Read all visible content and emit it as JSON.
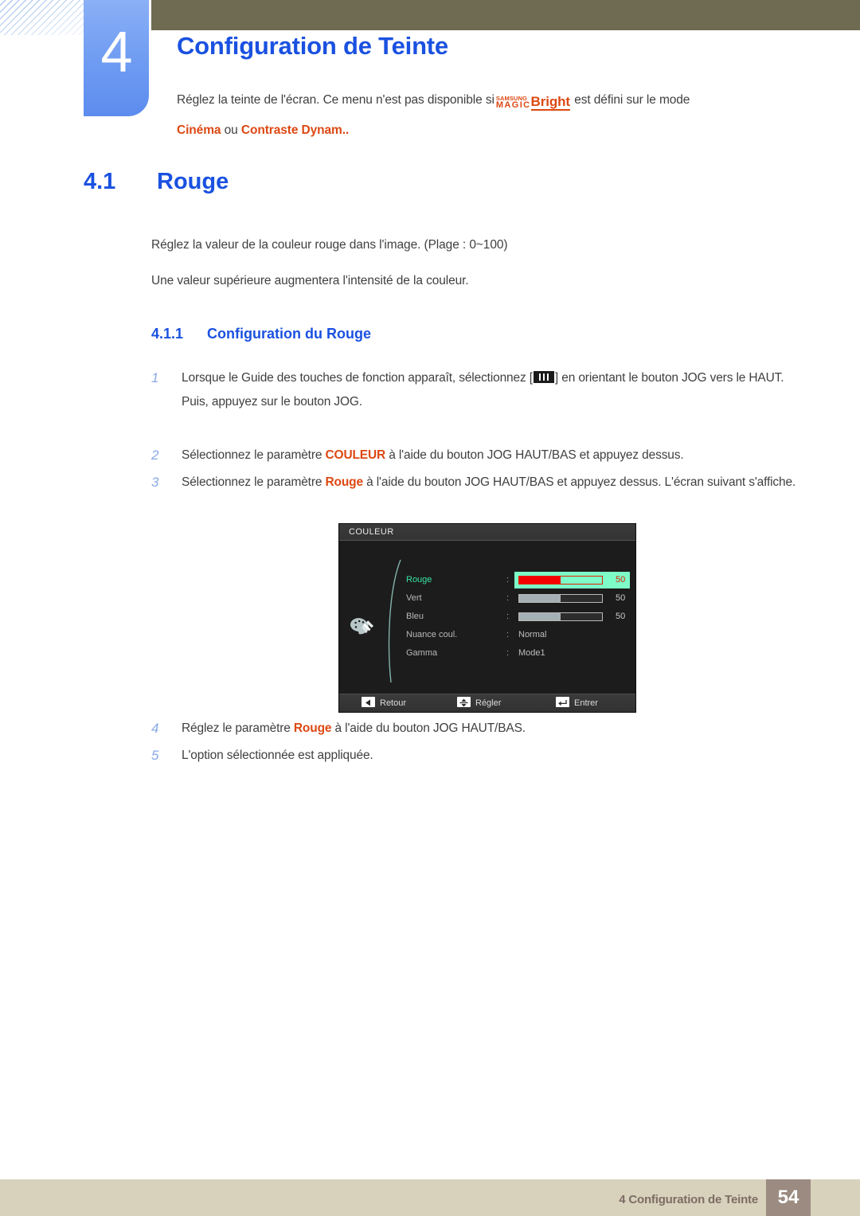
{
  "chapter": {
    "number": "4",
    "title": "Configuration de Teinte",
    "intro_before": "Réglez la teinte de l'écran. Ce menu n'est pas disponible si",
    "logo": {
      "samsung": "SAMSUNG",
      "magic": "MAGIC",
      "bright": "Bright"
    },
    "intro_after": "est défini sur le mode",
    "intro_mode_1": "Cinéma",
    "intro_mode_or": "ou",
    "intro_mode_2": "Contraste Dynam.."
  },
  "section": {
    "number": "4.1",
    "title": "Rouge",
    "paragraph_1": "Réglez la valeur de la couleur rouge dans l'image. (Plage : 0~100)",
    "paragraph_2": "Une valeur supérieure augmentera l'intensité de la couleur."
  },
  "subsection": {
    "number": "4.1.1",
    "title": "Configuration du Rouge"
  },
  "steps": [
    {
      "index": "1",
      "part_a": "Lorsque le Guide des touches de fonction apparaît, sélectionnez [",
      "icon": "jog-bars-icon",
      "part_b": "] en orientant le bouton JOG vers le HAUT.",
      "extra": "Puis, appuyez sur le bouton JOG."
    },
    {
      "index": "2",
      "part_a": "Sélectionnez le paramètre",
      "highlight": "COULEUR",
      "part_b": "à l'aide du bouton JOG HAUT/BAS et appuyez dessus."
    },
    {
      "index": "3",
      "part_a": "Sélectionnez le paramètre",
      "highlight": "Rouge",
      "part_b": "à l'aide du bouton JOG HAUT/BAS et appuyez dessus. L'écran suivant s'affiche."
    },
    {
      "index": "4",
      "part_a": "Réglez le paramètre",
      "highlight": "Rouge",
      "part_b": "à l'aide du bouton JOG HAUT/BAS."
    },
    {
      "index": "5",
      "part_a": "L'option sélectionnée est appliquée."
    }
  ],
  "osd": {
    "title": "COULEUR",
    "icon": "color-palette-icon",
    "rows": [
      {
        "label": "Rouge",
        "colon": ":",
        "type": "slider",
        "percent": 50,
        "number": "50",
        "selected": true
      },
      {
        "label": "Vert",
        "colon": ":",
        "type": "slider",
        "percent": 50,
        "number": "50",
        "selected": false
      },
      {
        "label": "Bleu",
        "colon": ":",
        "type": "slider",
        "percent": 50,
        "number": "50",
        "selected": false
      },
      {
        "label": "Nuance coul.",
        "colon": ":",
        "type": "value",
        "value": "Normal",
        "selected": false
      },
      {
        "label": "Gamma",
        "colon": ":",
        "type": "value",
        "value": "Mode1",
        "selected": false
      }
    ],
    "footer": [
      {
        "icon": "left-arrow-icon",
        "label": "Retour"
      },
      {
        "icon": "up-down-arrow-icon",
        "label": "Régler"
      },
      {
        "icon": "enter-arrow-icon",
        "label": "Entrer"
      }
    ],
    "colors": {
      "highlight": "#7dfcc8",
      "red_fill": "#f40000",
      "selected_label": "#37e3a4",
      "bar_fill": "#a5b0b4"
    }
  },
  "footer": {
    "text": "4 Configuration de Teinte",
    "page": "54"
  },
  "theme": {
    "heading_blue": "#1a51e0",
    "accent_orange": "#dd4813",
    "topbar_olive": "#6f6a52",
    "footer_beige": "#d8d2bd",
    "page_box_brown": "#9b8b80"
  }
}
